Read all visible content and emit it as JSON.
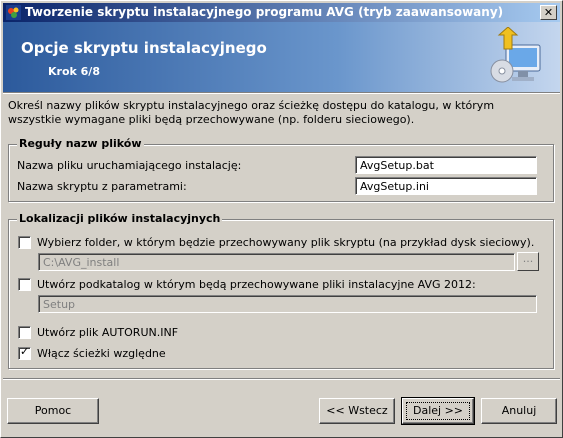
{
  "window": {
    "title": "Tworzenie skryptu instalacyjnego programu AVG (tryb zaawansowany)",
    "close_label": "✕"
  },
  "header": {
    "title": "Opcje skryptu instalacyjnego",
    "step": "Krok 6/8"
  },
  "description": "Określ nazwy plików skryptu instalacyjnego oraz ścieżkę dostępu do katalogu, w którym wszystkie wymagane pliki będą przechowywane (np. folderu sieciowego).",
  "naming": {
    "legend": "Reguły nazw plików",
    "launcher_label": "Nazwa pliku uruchamiającego instalację:",
    "launcher_value": "AvgSetup.bat",
    "params_label": "Nazwa skryptu z parametrami:",
    "params_value": "AvgSetup.ini"
  },
  "locations": {
    "legend": "Lokalizacji plików instalacyjnych",
    "folder_check_label": "Wybierz folder, w którym będzie przechowywany plik skryptu (na przykład dysk sieciowy).",
    "folder_checked": false,
    "folder_value": "C:\\AVG_install",
    "browse_label": "...",
    "subdir_check_label": "Utwórz podkatalog w którym będą przechowywane pliki instalacyjne AVG 2012:",
    "subdir_checked": false,
    "subdir_value": "Setup",
    "autorun_label": "Utwórz plik AUTORUN.INF",
    "autorun_checked": false,
    "relative_label": "Włącz ścieżki względne",
    "relative_checked": true
  },
  "buttons": {
    "help": "Pomoc",
    "back": "<< Wstecz",
    "next": "Dalej >>",
    "cancel": "Anuluj"
  },
  "colors": {
    "title_start": "#0a246a",
    "title_end": "#a6caf0",
    "header_start": "#2c5a9c"
  }
}
